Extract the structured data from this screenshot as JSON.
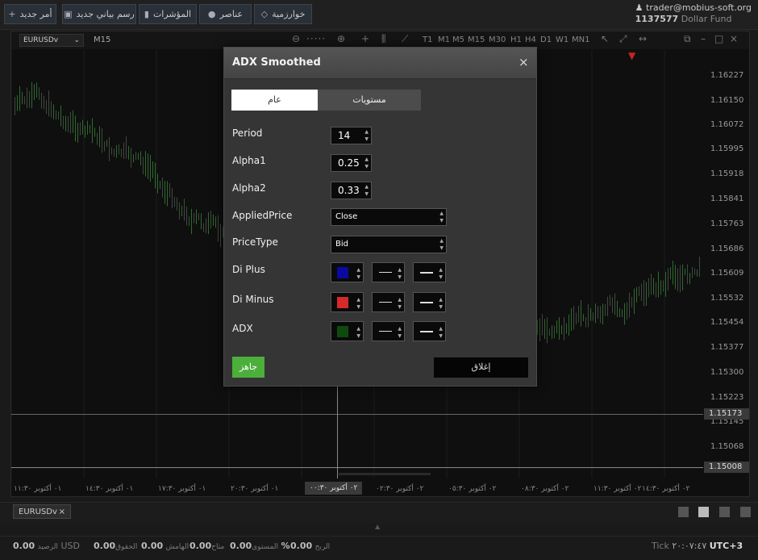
{
  "toolbar": {
    "new_order": "أمر جديد",
    "new_chart": "رسم بياني جديد",
    "indicators": "المؤشرات",
    "elements": "عناصر",
    "algorithms": "خوارزمية"
  },
  "account": {
    "email": "trader@mobius-soft.org",
    "number": "1137577",
    "fund": "Dollar Fund"
  },
  "chart": {
    "symbol": "EURUSDv",
    "timeframe": "M15",
    "timeframes": [
      "T1",
      "M1",
      "M5",
      "M15",
      "M30",
      "H1",
      "H4",
      "D1",
      "W1",
      "MN1"
    ],
    "prices": [
      "1.16227",
      "1.16150",
      "1.16072",
      "1.15995",
      "1.15918",
      "1.15841",
      "1.15763",
      "1.15686",
      "1.15609",
      "1.15532",
      "1.15454",
      "1.15377",
      "1.15300",
      "1.15223",
      "1.15145",
      "1.15068"
    ],
    "current_price": "1.15173",
    "crosshair_price": "1.15008",
    "times": [
      "٠١ أكتوبر ١١:٣٠",
      "٠١ أكتوبر ١٤:٣٠",
      "٠١ أكتوبر ١٧:٣٠",
      "٠١ أكتوبر ٢٠:٣٠",
      "٠٢ أكتوبر ٠٢:٣٠",
      "٠٢ أكتوبر ٠٥:٣٠",
      "٠٢ أكتوبر ٠٨:٣٠",
      "٠٢ أكتوبر ١١:٣٠",
      "٠٢ أكتوبر ١٤:٣٠"
    ],
    "crosshair_time": "٠٢ أكتوبر ٠٠:٣٠"
  },
  "tabs": {
    "chart_tab": "EURUSDv"
  },
  "status": {
    "balance_label": "الرصيد",
    "balance_value": "0.00",
    "currency": "USD",
    "equity_label": "الحقوق",
    "equity_value": "0.00",
    "margin_label": "الهامش",
    "margin_value": "0.00",
    "free_label": "متاح",
    "free_value": "0.00",
    "level_label": "المستوى",
    "level_value": "%",
    "profit_label": "الربح",
    "profit_value": "0.00",
    "tick_label": "Tick",
    "tick_value": "٢٠:٠٧:٤٧",
    "timezone": "UTC+3"
  },
  "dialog": {
    "title": "ADX Smoothed",
    "close_icon": "×",
    "tab_general": "عام",
    "tab_levels": "مستويات",
    "period_label": "Period",
    "period_value": "14",
    "alpha1_label": "Alpha1",
    "alpha1_value": "0.25",
    "alpha2_label": "Alpha2",
    "alpha2_value": "0.33",
    "applied_price_label": "AppliedPrice",
    "applied_price_value": "Close",
    "price_type_label": "PriceType",
    "price_type_value": "Bid",
    "di_plus_label": "Di Plus",
    "di_plus_color": "#0a0aa0",
    "di_minus_label": "Di Minus",
    "di_minus_color": "#d42a2a",
    "adx_label": "ADX",
    "adx_color": "#0e4a0e",
    "ready_button": "جاهز",
    "close_button": "إغلاق"
  }
}
